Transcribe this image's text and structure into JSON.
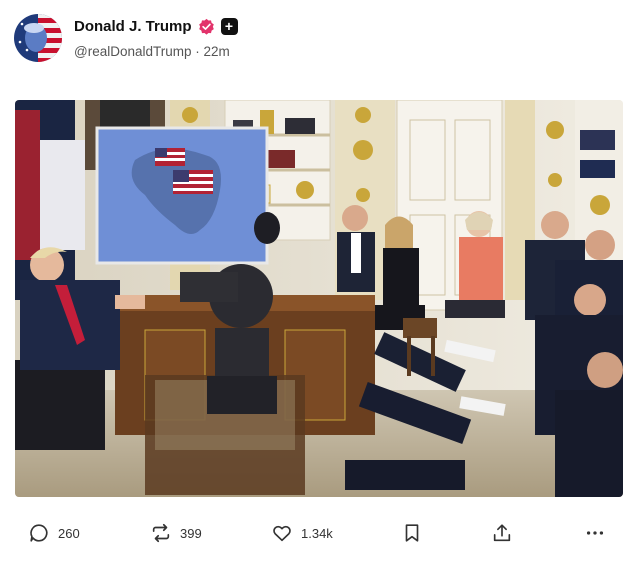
{
  "post": {
    "author": {
      "display_name": "Donald J. Trump",
      "handle": "@realDonaldTrump",
      "separator": "·",
      "time_ago": "22m",
      "verified": true
    },
    "media": {
      "description_icon": "photo"
    }
  },
  "actions": {
    "replies": "260",
    "reposts": "399",
    "likes": "1.34k"
  },
  "colors": {
    "verified_badge": "#e2336b",
    "text_primary": "#111111",
    "text_secondary": "#555555"
  }
}
